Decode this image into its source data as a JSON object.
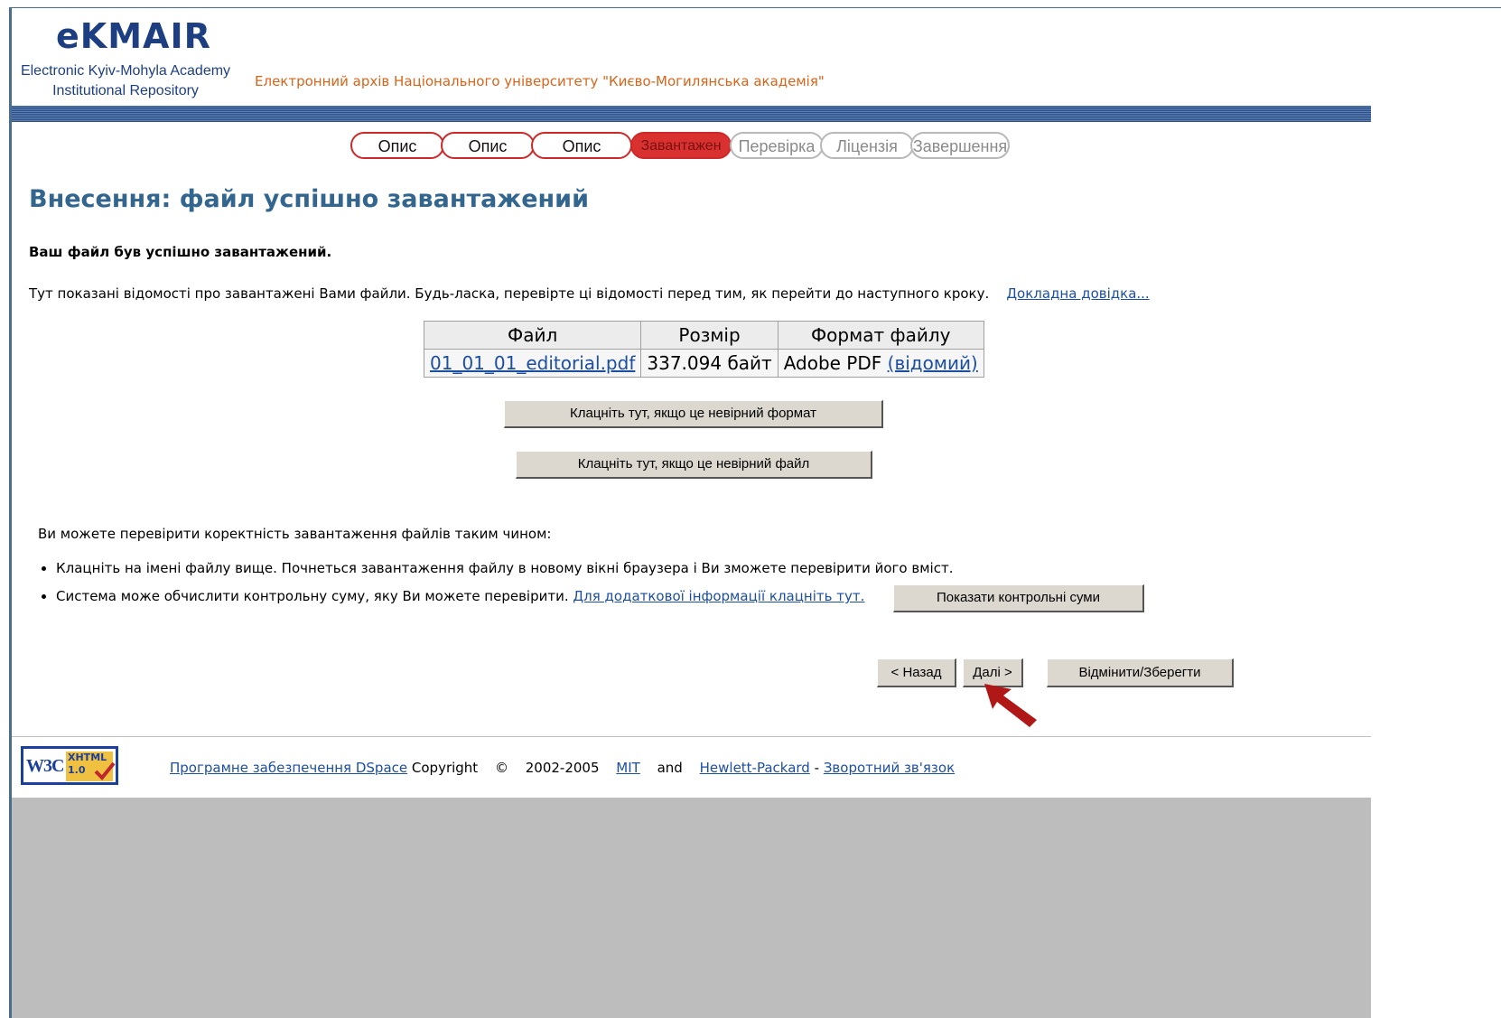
{
  "header": {
    "logo_title": "eKMAIR",
    "logo_subtitle_line1": "Electronic Kyiv-Mohyla Academy",
    "logo_subtitle_line2": "Institutional Repository",
    "tagline": "Електронний архів Національного університету \"Києво-Могилянська академія\""
  },
  "progress_steps": [
    {
      "label": "Опис",
      "state": "done"
    },
    {
      "label": "Опис",
      "state": "done"
    },
    {
      "label": "Опис",
      "state": "done"
    },
    {
      "label": "Завантажен",
      "state": "current"
    },
    {
      "label": "Перевірка",
      "state": "todo"
    },
    {
      "label": "Ліцензія",
      "state": "todo"
    },
    {
      "label": "Завершення",
      "state": "todo"
    }
  ],
  "main": {
    "title": "Внесення: файл успішно завантажений",
    "success_message": "Ваш файл був успішно завантажений.",
    "intro_text": "Тут показані відомості про завантажені Вами файли. Будь-ласка, перевірте ці відомості перед тим, як перейти до наступного кроку.",
    "help_link": "Докладна довідка..."
  },
  "files_table": {
    "headers": [
      "Файл",
      "Розмір",
      "Формат файлу"
    ],
    "rows": [
      {
        "file": "01_01_01_editorial.pdf",
        "size": "337.094 байт",
        "format": "Adobe PDF",
        "format_status": "(відомий)"
      }
    ]
  },
  "buttons": {
    "wrong_format": "Клацніть тут, якщо це невірний формат",
    "wrong_file": "Клацніть тут, якщо це невірний файл",
    "show_checksums": "Показати контрольні суми",
    "back": "< Назад",
    "next": "Далі >",
    "cancel_save": "Відмінити/Зберегти"
  },
  "verify": {
    "intro": "Ви можете перевірити коректність завантаження файлів таким чином:",
    "item1": "Клацніть на імені файлу вище. Почнеться завантаження файлу в новому вікні браузера і Ви зможете перевірити його вміст.",
    "item2": "Система може обчислити контрольну суму, яку Ви можете перевірити.",
    "item2_link": "Для додаткової інформації клацніть тут."
  },
  "footer": {
    "badge_w3c": "W3C",
    "badge_xhtml": "XHTML",
    "badge_version": "1.0",
    "software_link": "Програмне забезпечення DSpace",
    "copyright": "Copyright",
    "copyright_symbol": "©",
    "years": "2002-2005",
    "mit_link": "MIT",
    "and": "and",
    "hp_link": "Hewlett-Packard",
    "dash": "-",
    "feedback_link": "Зворотний зв'язок"
  },
  "colors": {
    "brand_blue": "#1d3f82",
    "title_blue": "#33668f",
    "tagline_orange": "#d8641a",
    "step_red": "#cc2a2a",
    "arrow_red": "#b01818",
    "button_face": "#dcd8cf"
  }
}
